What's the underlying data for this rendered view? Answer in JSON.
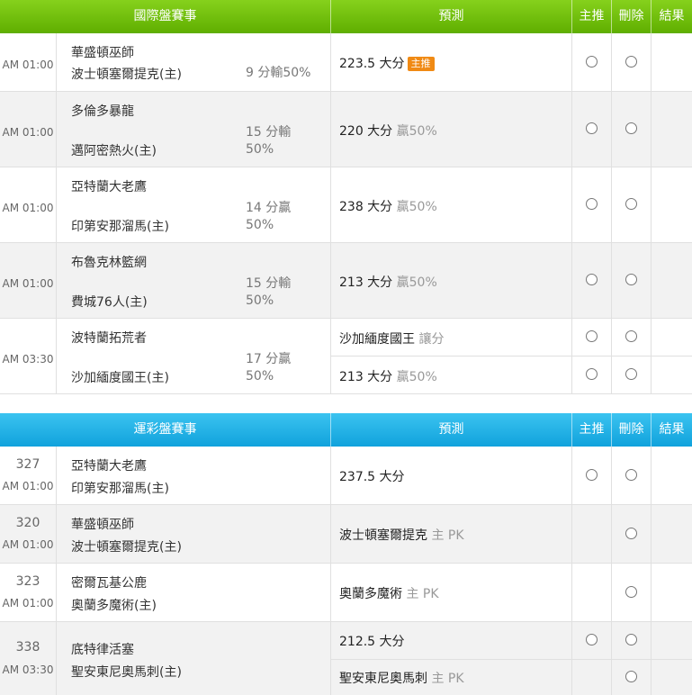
{
  "intl": {
    "headers": {
      "match": "國際盤賽事",
      "pred": "預測",
      "main": "主推",
      "del": "刪除",
      "res": "結果"
    },
    "rows": [
      {
        "time": "AM 01:00",
        "team1": "華盛頓巫師",
        "team2": "波士頓塞爾提克(主)",
        "odds": "9 分輸50%",
        "pred_main": "223.5 大分",
        "pred_sub": "",
        "badge": "主推"
      },
      {
        "time": "AM 01:00",
        "team1": "多倫多暴龍",
        "team2": "邁阿密熱火(主)",
        "odds": "15 分輸 50%",
        "pred_main": "220 大分",
        "pred_sub": "贏50%"
      },
      {
        "time": "AM 01:00",
        "team1": "亞特蘭大老鷹",
        "team2": "印第安那溜馬(主)",
        "odds": "14 分贏 50%",
        "pred_main": "238 大分",
        "pred_sub": "贏50%"
      },
      {
        "time": "AM 01:00",
        "team1": "布魯克林籃網",
        "team2": "費城76人(主)",
        "odds": "15 分輸 50%",
        "pred_main": "213 大分",
        "pred_sub": "贏50%"
      },
      {
        "time": "AM 03:30",
        "team1": "波特蘭拓荒者",
        "team2": "沙加緬度國王(主)",
        "odds": "17 分贏 50%",
        "pred_main": "沙加緬度國王",
        "pred_sub": "讓分",
        "pred2_main": "213 大分",
        "pred2_sub": "贏50%"
      }
    ]
  },
  "lottery": {
    "headers": {
      "match": "運彩盤賽事",
      "pred": "預測",
      "main": "主推",
      "del": "刪除",
      "res": "結果"
    },
    "rows": [
      {
        "num": "327",
        "time": "AM 01:00",
        "team1": "亞特蘭大老鷹",
        "team2": "印第安那溜馬(主)",
        "pred_main": "237.5 大分",
        "pred_sub": ""
      },
      {
        "num": "320",
        "time": "AM 01:00",
        "team1": "華盛頓巫師",
        "team2": "波士頓塞爾提克(主)",
        "pred_main": "波士頓塞爾提克",
        "pred_sub": "主 PK"
      },
      {
        "num": "323",
        "time": "AM 01:00",
        "team1": "密爾瓦基公鹿",
        "team2": "奧蘭多魔術(主)",
        "pred_main": "奧蘭多魔術",
        "pred_sub": "主 PK"
      },
      {
        "num": "338",
        "time": "AM 03:30",
        "team1": "底特律活塞",
        "team2": "聖安東尼奧馬刺(主)",
        "pred_main": "212.5 大分",
        "pred_sub": "",
        "pred2_main": "聖安東尼奧馬刺",
        "pred2_sub": "主 PK"
      }
    ]
  }
}
